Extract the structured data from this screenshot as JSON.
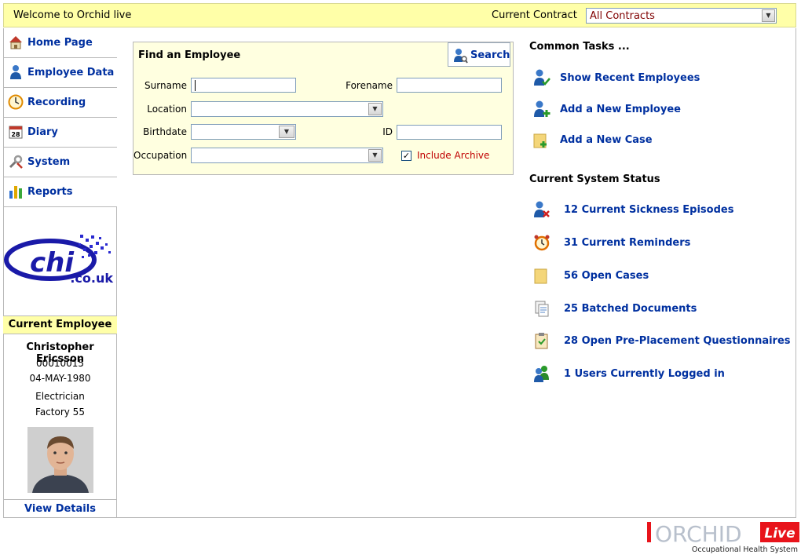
{
  "header": {
    "welcome": "Welcome to Orchid live",
    "contract_label": "Current Contract",
    "contract_value": "All Contracts"
  },
  "sidebar": {
    "items": [
      {
        "label": "Home Page",
        "icon": "home-icon"
      },
      {
        "label": "Employee Data",
        "icon": "person-icon"
      },
      {
        "label": "Recording",
        "icon": "clock-icon"
      },
      {
        "label": "Diary",
        "icon": "calendar-icon"
      },
      {
        "label": "System",
        "icon": "tools-icon"
      },
      {
        "label": "Reports",
        "icon": "bar-chart-icon"
      }
    ],
    "logo_main": "chi",
    "logo_domain": ".co.uk"
  },
  "current_employee": {
    "title": "Current Employee",
    "name": "Christopher Ericsson",
    "id": "00010015",
    "dob": "04-MAY-1980",
    "occupation": "Electrician",
    "location": "Factory 55",
    "view_details": "View Details"
  },
  "find": {
    "title": "Find an Employee",
    "search_label": "Search",
    "surname_label": "Surname",
    "forename_label": "Forename",
    "location_label": "Location",
    "birthdate_label": "Birthdate",
    "id_label": "ID",
    "occupation_label": "Occupation",
    "include_archive_label": "Include Archive",
    "include_archive_checked": true
  },
  "common_tasks": {
    "title": "Common Tasks ...",
    "items": [
      {
        "label": "Show Recent Employees",
        "icon": "person-check-icon"
      },
      {
        "label": "Add a New Employee",
        "icon": "person-add-icon"
      },
      {
        "label": "Add a New Case",
        "icon": "folder-add-icon"
      }
    ]
  },
  "system_status": {
    "title": "Current System Status",
    "items": [
      {
        "label": "12 Current Sickness Episodes",
        "icon": "person-cross-icon"
      },
      {
        "label": "31 Current Reminders",
        "icon": "alarm-clock-icon"
      },
      {
        "label": "56 Open Cases",
        "icon": "folder-icon"
      },
      {
        "label": "25 Batched Documents",
        "icon": "documents-icon"
      },
      {
        "label": "28 Open Pre-Placement Questionnaires",
        "icon": "clipboard-icon"
      },
      {
        "label": "1 Users Currently Logged in",
        "icon": "users-icon"
      }
    ]
  },
  "brand": {
    "name": "ORCHID",
    "badge": "Live",
    "tagline": "Occupational Health System"
  },
  "colors": {
    "header_bg": "#ffffa8",
    "link_blue": "#0030a0",
    "archive_red": "#c00000",
    "brand_red": "#e8141b"
  }
}
